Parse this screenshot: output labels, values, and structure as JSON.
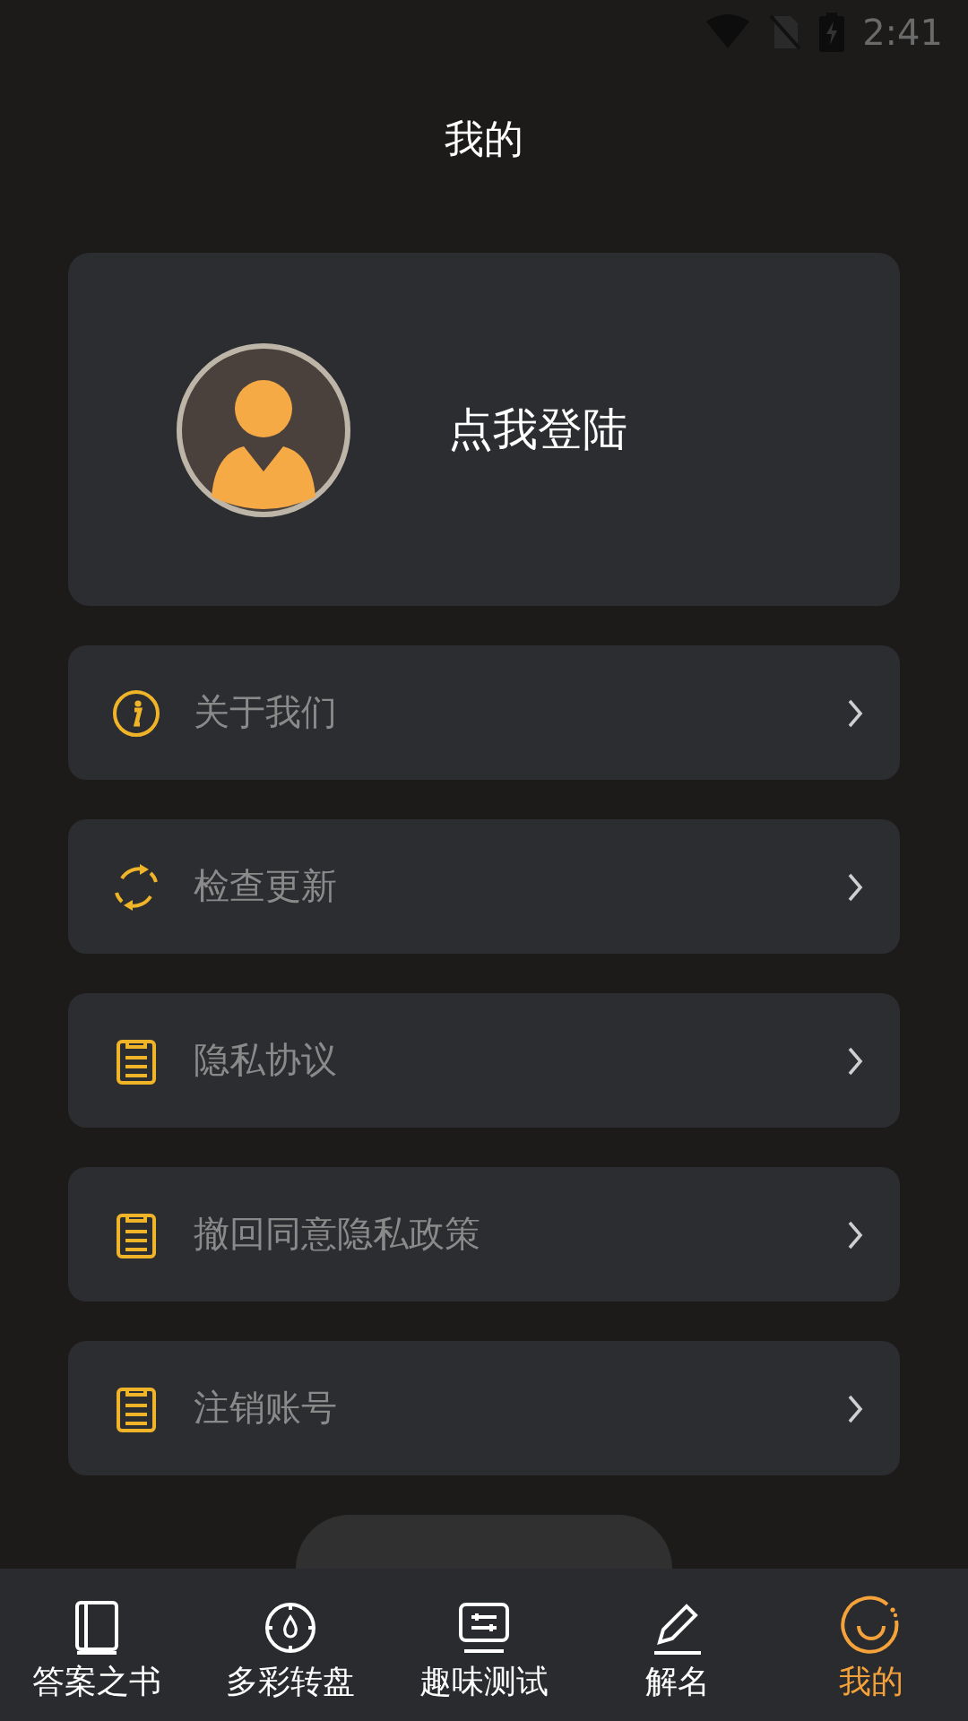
{
  "status_bar": {
    "time": "2:41"
  },
  "title": "我的",
  "profile": {
    "login_text": "点我登陆"
  },
  "menu": [
    {
      "kind": "info",
      "label": "关于我们"
    },
    {
      "kind": "refresh",
      "label": "检查更新"
    },
    {
      "kind": "note",
      "label": "隐私协议"
    },
    {
      "kind": "note",
      "label": "撤回同意隐私政策"
    },
    {
      "kind": "note",
      "label": "注销账号"
    }
  ],
  "nav": [
    {
      "kind": "book",
      "label": "答案之书",
      "selected": false
    },
    {
      "kind": "dial",
      "label": "多彩转盘",
      "selected": false
    },
    {
      "kind": "sliders",
      "label": "趣味测试",
      "selected": false
    },
    {
      "kind": "pencil",
      "label": "解名",
      "selected": false
    },
    {
      "kind": "smile",
      "label": "我的",
      "selected": true
    }
  ]
}
